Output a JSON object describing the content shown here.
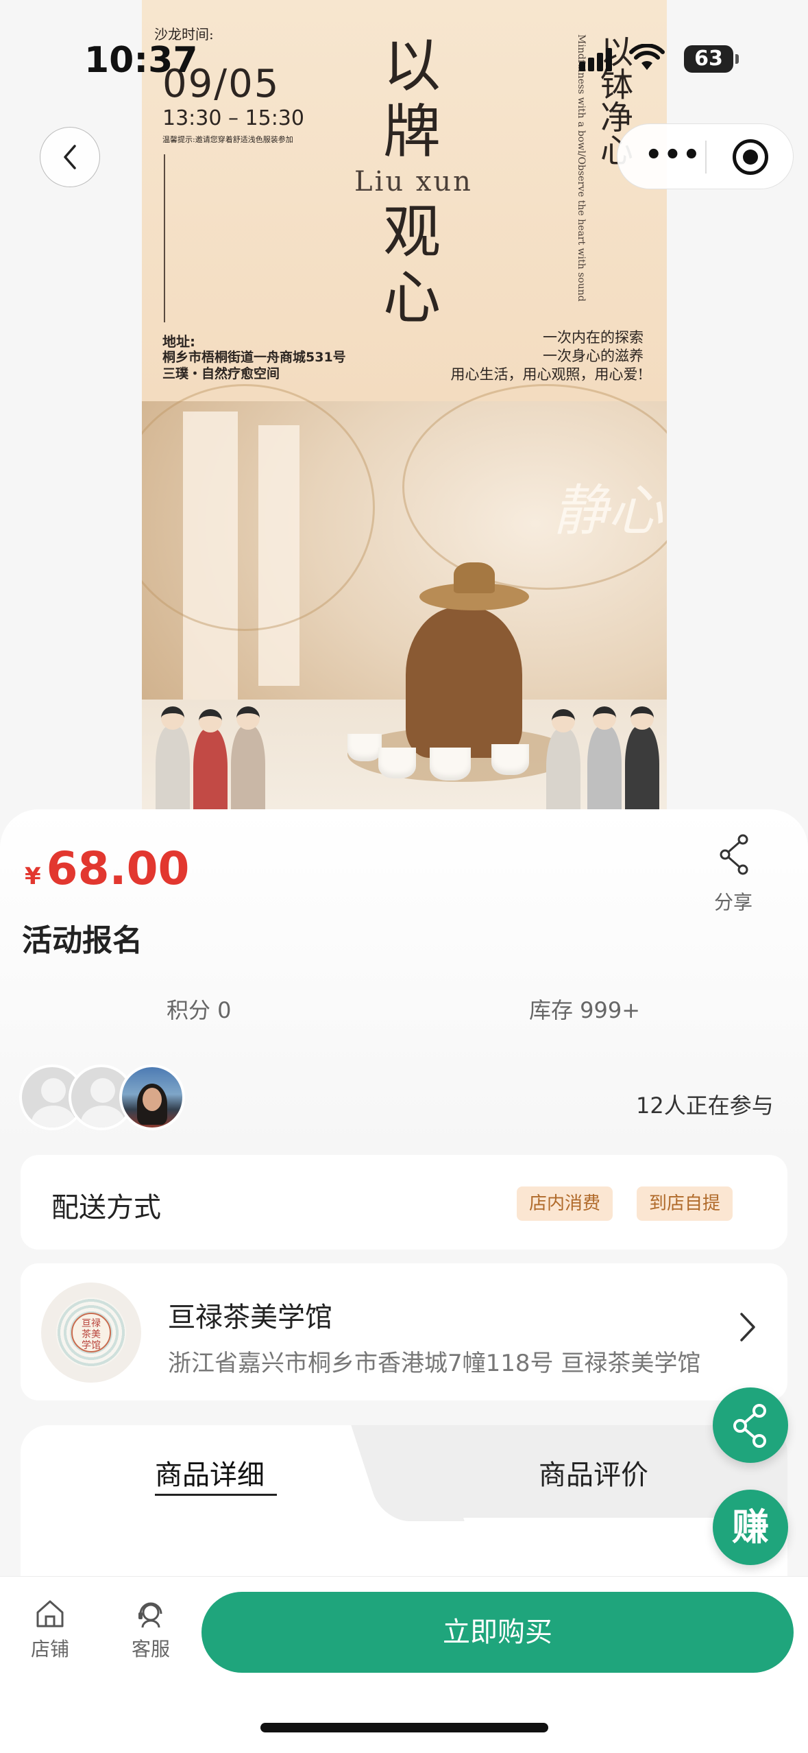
{
  "status_bar": {
    "time": "10:37",
    "battery": "63"
  },
  "poster": {
    "salon_time_label": "沙龙时间:",
    "date": "09/05",
    "time_range": "13:30 – 15:30",
    "tip": "温馨提示:邀请您穿着舒适浅色服装参加",
    "title_chars": [
      "以",
      "牌",
      "观",
      "心"
    ],
    "pinyin": "Liu xun",
    "vertical_cn": "以钵净心",
    "vertical_en": "Mindfulness with a bowl/Observe the heart with sound",
    "address_label": "地址:",
    "address_line1": "桐乡市梧桐街道一舟商城531号",
    "address_line2": "三璞・自然疗愈空间",
    "slogan1": "一次内在的探索",
    "slogan2": "一次身心的滋养",
    "slogan3": "用心生活，用心观照，用心爱!",
    "calligraphy": "静心"
  },
  "product": {
    "currency": "¥",
    "price": "68.00",
    "share_label": "分享",
    "title": "活动报名",
    "points": "积分 0",
    "stock": "库存 999+",
    "participants": "12人正在参与"
  },
  "delivery": {
    "label": "配送方式",
    "options": [
      "店内消费",
      "到店自提"
    ]
  },
  "store": {
    "name": "亘禄茶美学馆",
    "address": "浙江省嘉兴市桐乡市香港城7幢118号 亘禄茶美学馆",
    "logo_text": "亘禄\n茶美\n学馆"
  },
  "tabs": {
    "detail": "商品详细",
    "reviews": "商品评价"
  },
  "floating": {
    "earn": "赚"
  },
  "bottom_bar": {
    "store_label": "店铺",
    "service_label": "客服",
    "buy_label": "立即购买"
  },
  "colors": {
    "accent": "#1fa57c",
    "price": "#e2372f",
    "tag_bg": "#fbe6d2",
    "tag_text": "#b06a2a"
  },
  "icons": [
    "back-arrow-icon",
    "more-dots-icon",
    "target-icon",
    "share-icon",
    "chevron-right-icon",
    "share-fab-icon",
    "home-icon",
    "customer-service-icon"
  ]
}
